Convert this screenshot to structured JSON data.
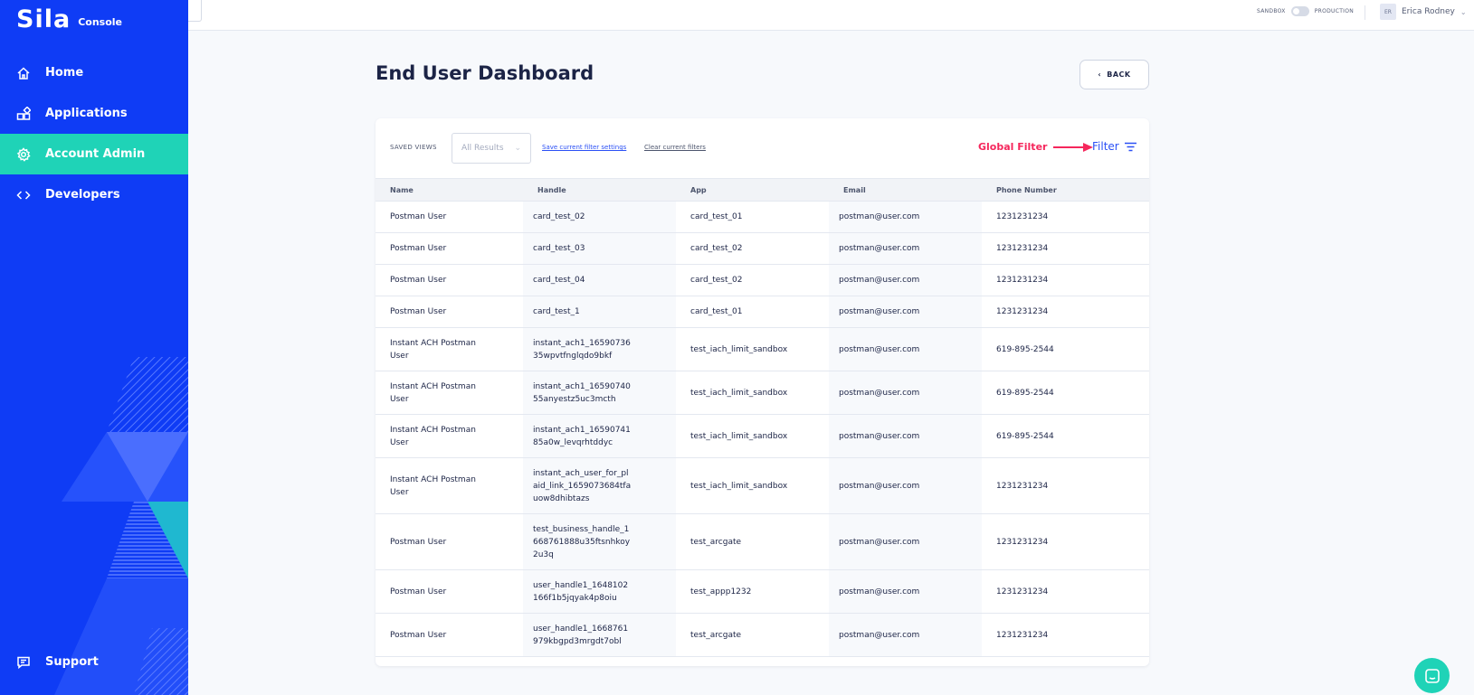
{
  "app": {
    "logo_text": "Sila",
    "logo_sub": "Console"
  },
  "sidebar": {
    "items": [
      {
        "label": "Home",
        "icon": "home-icon"
      },
      {
        "label": "Applications",
        "icon": "applications-icon"
      },
      {
        "label": "Account Admin",
        "icon": "gear-icon",
        "active": true
      },
      {
        "label": "Developers",
        "icon": "code-icon"
      }
    ],
    "support_label": "Support"
  },
  "topbar": {
    "env_left": "SANDBOX",
    "env_right": "PRODUCTION",
    "avatar_initials": "ER",
    "user_name": "Erica Rodney"
  },
  "page": {
    "title": "End User Dashboard",
    "back_label": "BACK"
  },
  "toolbar": {
    "saved_views_label": "SAVED VIEWS",
    "saved_views_value": "All Results",
    "save_link": "Save current filter settings",
    "clear_link": "Clear current filters",
    "global_filter_annotation": "Global Filter",
    "filter_label": "Filter"
  },
  "table": {
    "columns": [
      "Name",
      "Handle",
      "App",
      "Email",
      "Phone Number"
    ],
    "rows": [
      {
        "name": "Postman User",
        "handle": "card_test_02",
        "app": "card_test_01",
        "email": "postman@user.com",
        "phone": "1231231234"
      },
      {
        "name": "Postman User",
        "handle": "card_test_03",
        "app": "card_test_02",
        "email": "postman@user.com",
        "phone": "1231231234"
      },
      {
        "name": "Postman User",
        "handle": "card_test_04",
        "app": "card_test_02",
        "email": "postman@user.com",
        "phone": "1231231234"
      },
      {
        "name": "Postman User",
        "handle": "card_test_1",
        "app": "card_test_01",
        "email": "postman@user.com",
        "phone": "1231231234"
      },
      {
        "name": "Instant ACH Postman User",
        "handle": "instant_ach1_1659073635wpvtfnglqdo9bkf",
        "app": "test_iach_limit_sandbox",
        "email": "postman@user.com",
        "phone": "619-895-2544"
      },
      {
        "name": "Instant ACH Postman User",
        "handle": "instant_ach1_1659074055anyestz5uc3mcth",
        "app": "test_iach_limit_sandbox",
        "email": "postman@user.com",
        "phone": "619-895-2544"
      },
      {
        "name": "Instant ACH Postman User",
        "handle": "instant_ach1_1659074185a0w_levqrhtddyc",
        "app": "test_iach_limit_sandbox",
        "email": "postman@user.com",
        "phone": "619-895-2544"
      },
      {
        "name": "Instant ACH Postman User",
        "handle": "instant_ach_user_for_plaid_link_1659073684tfauow8dhibtazs",
        "app": "test_iach_limit_sandbox",
        "email": "postman@user.com",
        "phone": "1231231234"
      },
      {
        "name": "Postman User",
        "handle": "test_business_handle_1668761888u35ftsnhkoy2u3q",
        "app": "test_arcgate",
        "email": "postman@user.com",
        "phone": "1231231234"
      },
      {
        "name": "Postman User",
        "handle": "user_handle1_1648102166f1b5jqyak4p8oiu",
        "app": "test_appp1232",
        "email": "postman@user.com",
        "phone": "1231231234"
      },
      {
        "name": "Postman User",
        "handle": "user_handle1_1668761979kbgpd3mrgdt7obl",
        "app": "test_arcgate",
        "email": "postman@user.com",
        "phone": "1231231234"
      }
    ]
  },
  "colors": {
    "sidebar": "#0f3cf5",
    "active": "#1fd3b7",
    "link": "#2b50f5",
    "annotation": "#f5275c"
  }
}
